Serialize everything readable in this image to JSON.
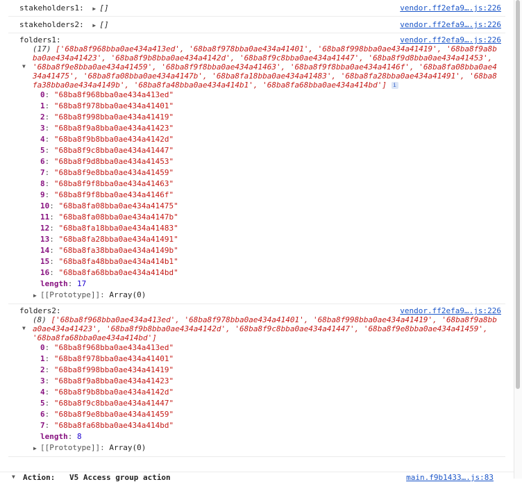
{
  "messages": {
    "stakeholders1": {
      "label": "stakeholders1:",
      "value": "[]",
      "source": "vendor.ff2efa9….js:226"
    },
    "stakeholders2": {
      "label": "stakeholders2:",
      "value": "[]",
      "source": "vendor.ff2efa9….js:226"
    },
    "folders1": {
      "label": "folders1:",
      "source": "vendor.ff2efa9….js:226",
      "count": "(17)",
      "preview": "['68ba8f968bba0ae434a413ed', '68ba8f978bba0ae434a41401', '68ba8f998bba0ae434a41419', '68ba8f9a8bba0ae434a41423', '68ba8f9b8bba0ae434a4142d', '68ba8f9c8bba0ae434a41447', '68ba8f9d8bba0ae434a41453', '68ba8f9e8bba0ae434a41459', '68ba8f9f8bba0ae434a41463', '68ba8f9f8bba0ae434a4146f', '68ba8fa08bba0ae434a41475', '68ba8fa08bba0ae434a4147b', '68ba8fa18bba0ae434a41483', '68ba8fa28bba0ae434a41491', '68ba8fa38bba0ae434a4149b', '68ba8fa48bba0ae434a414b1', '68ba8fa68bba0ae434a414bd']",
      "items": [
        {
          "k": "0",
          "v": "\"68ba8f968bba0ae434a413ed\""
        },
        {
          "k": "1",
          "v": "\"68ba8f978bba0ae434a41401\""
        },
        {
          "k": "2",
          "v": "\"68ba8f998bba0ae434a41419\""
        },
        {
          "k": "3",
          "v": "\"68ba8f9a8bba0ae434a41423\""
        },
        {
          "k": "4",
          "v": "\"68ba8f9b8bba0ae434a4142d\""
        },
        {
          "k": "5",
          "v": "\"68ba8f9c8bba0ae434a41447\""
        },
        {
          "k": "6",
          "v": "\"68ba8f9d8bba0ae434a41453\""
        },
        {
          "k": "7",
          "v": "\"68ba8f9e8bba0ae434a41459\""
        },
        {
          "k": "8",
          "v": "\"68ba8f9f8bba0ae434a41463\""
        },
        {
          "k": "9",
          "v": "\"68ba8f9f8bba0ae434a4146f\""
        },
        {
          "k": "10",
          "v": "\"68ba8fa08bba0ae434a41475\""
        },
        {
          "k": "11",
          "v": "\"68ba8fa08bba0ae434a4147b\""
        },
        {
          "k": "12",
          "v": "\"68ba8fa18bba0ae434a41483\""
        },
        {
          "k": "13",
          "v": "\"68ba8fa28bba0ae434a41491\""
        },
        {
          "k": "14",
          "v": "\"68ba8fa38bba0ae434a4149b\""
        },
        {
          "k": "15",
          "v": "\"68ba8fa48bba0ae434a414b1\""
        },
        {
          "k": "16",
          "v": "\"68ba8fa68bba0ae434a414bd\""
        }
      ],
      "length_key": "length",
      "length_value": "17",
      "prototype_key": "[[Prototype]]",
      "prototype_value": "Array(0)"
    },
    "folders2": {
      "label": "folders2:",
      "source": "vendor.ff2efa9….js:226",
      "count": "(8)",
      "preview": "['68ba8f968bba0ae434a413ed', '68ba8f978bba0ae434a41401', '68ba8f998bba0ae434a41419', '68ba8f9a8bba0ae434a41423', '68ba8f9b8bba0ae434a4142d', '68ba8f9c8bba0ae434a41447', '68ba8f9e8bba0ae434a41459', '68ba8fa68bba0ae434a414bd']",
      "items": [
        {
          "k": "0",
          "v": "\"68ba8f968bba0ae434a413ed\""
        },
        {
          "k": "1",
          "v": "\"68ba8f978bba0ae434a41401\""
        },
        {
          "k": "2",
          "v": "\"68ba8f998bba0ae434a41419\""
        },
        {
          "k": "3",
          "v": "\"68ba8f9a8bba0ae434a41423\""
        },
        {
          "k": "4",
          "v": "\"68ba8f9b8bba0ae434a4142d\""
        },
        {
          "k": "5",
          "v": "\"68ba8f9c8bba0ae434a41447\""
        },
        {
          "k": "6",
          "v": "\"68ba8f9e8bba0ae434a41459\""
        },
        {
          "k": "7",
          "v": "\"68ba8fa68bba0ae434a414bd\""
        }
      ],
      "length_key": "length",
      "length_value": "8",
      "prototype_key": "[[Prototype]]",
      "prototype_value": "Array(0)"
    },
    "action": {
      "label": "Action:",
      "text": "V5 Access group action",
      "source": "main.f9b1433….js:83"
    }
  },
  "colors": {
    "link": "#1a55c8",
    "string": "#c41a16",
    "key": "#881280",
    "number": "#1c00cf"
  },
  "icons": {
    "expand": "triangle-right-icon",
    "collapse": "triangle-down-icon",
    "info": "info-icon"
  }
}
